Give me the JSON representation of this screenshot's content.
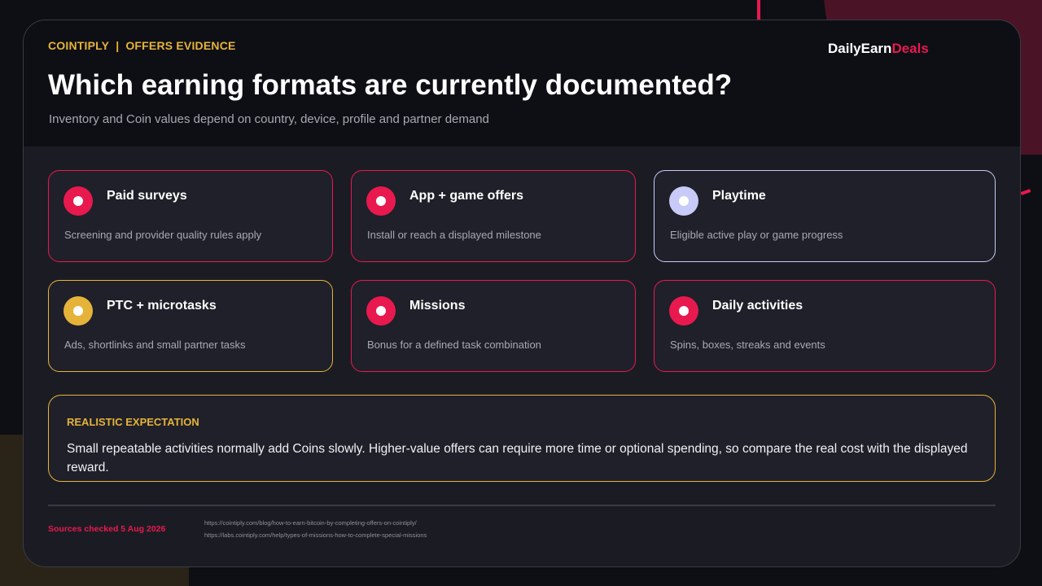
{
  "header": {
    "eyebrow_left": "COINTIPLY",
    "eyebrow_sep": "|",
    "eyebrow_right": "OFFERS EVIDENCE",
    "brand_main": "DailyEarn",
    "brand_accent": "Deals",
    "title": "Which earning formats are currently documented?",
    "subtitle": "Inventory and Coin values depend on country, device, profile and partner demand"
  },
  "cards": [
    {
      "title": "Paid surveys",
      "desc": "Screening and provider quality rules apply",
      "color": "#e8194f"
    },
    {
      "title": "App + game offers",
      "desc": "Install or reach a displayed milestone",
      "color": "#e8194f"
    },
    {
      "title": "Playtime",
      "desc": "Eligible active play or game progress",
      "color": "#c8caf7"
    },
    {
      "title": "PTC + microtasks",
      "desc": "Ads, shortlinks and small partner tasks",
      "color": "#e6b33a"
    },
    {
      "title": "Missions",
      "desc": "Bonus for a defined task combination",
      "color": "#e8194f"
    },
    {
      "title": "Daily activities",
      "desc": "Spins, boxes, streaks and events",
      "color": "#e8194f"
    }
  ],
  "callout": {
    "label": "REALISTIC EXPECTATION",
    "text": "Small repeatable activities normally add Coins slowly. Higher-value offers can require more time or optional spending, so compare the real cost with the displayed reward."
  },
  "footer": {
    "sources_label": "Sources checked 5 Aug 2026",
    "links": [
      "https://cointiply.com/blog/how-to-earn-bitcoin-by-completing-offers-on-cointiply/",
      "https://labs.cointiply.com/help/types-of-missions-how-to-complete-special-missions"
    ]
  },
  "colors": {
    "accent_red": "#e8194f",
    "accent_yellow": "#e6b33a",
    "accent_lavender": "#c8caf7",
    "background": "#0e0f14",
    "panel": "#1b1c23"
  }
}
